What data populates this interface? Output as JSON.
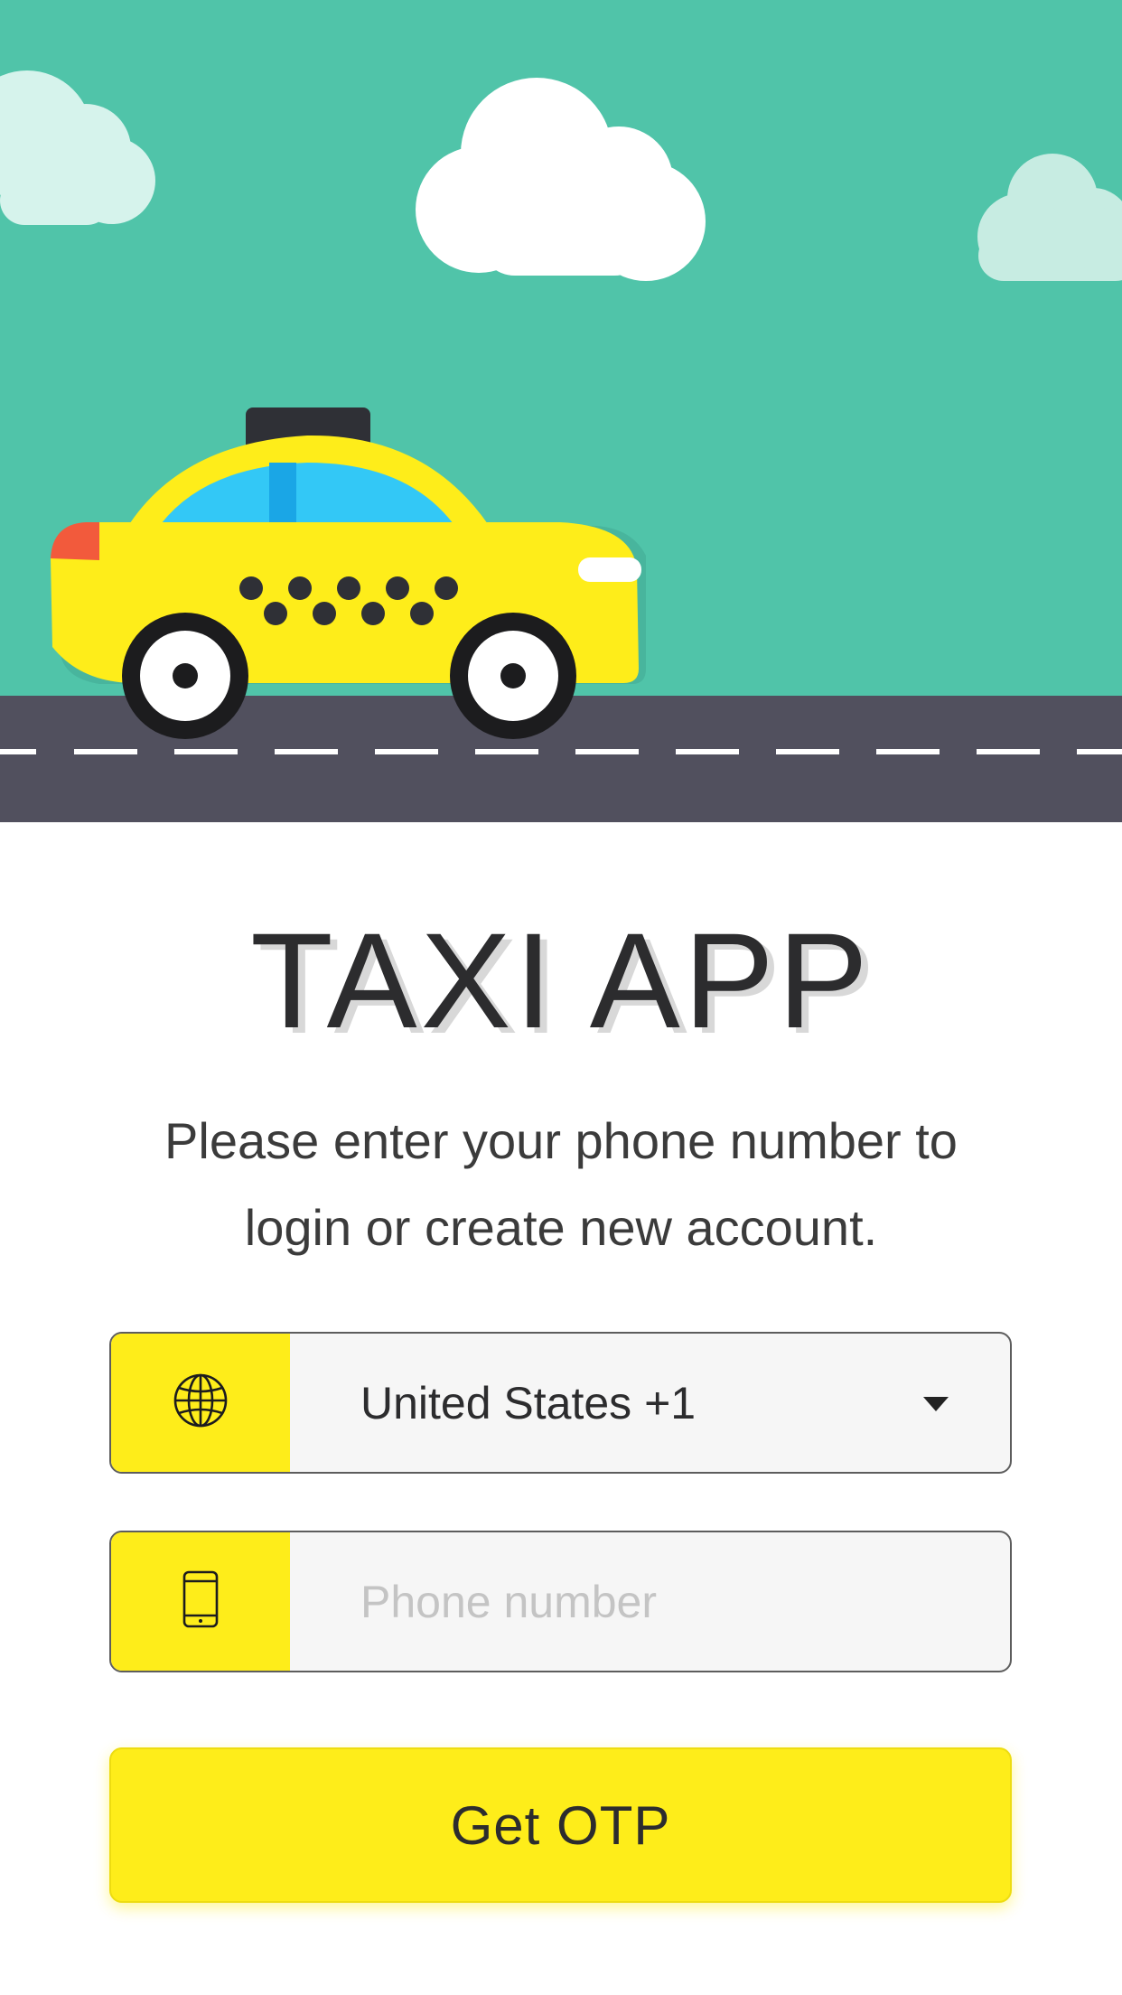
{
  "app": {
    "title": "TAXI APP"
  },
  "intro": {
    "message": "Please enter your phone number to login or create new account."
  },
  "country_select": {
    "icon": "globe-icon",
    "selected": "United States +1",
    "dropdown_icon": "caret-down-icon"
  },
  "phone_field": {
    "icon": "phone-icon",
    "value": "",
    "placeholder": "Phone number"
  },
  "otp_button": {
    "label": "Get OTP"
  },
  "colors": {
    "sky": "#50c4a9",
    "road": "#51505e",
    "accent_yellow": "#feed1a",
    "text": "#2c2c2e"
  }
}
